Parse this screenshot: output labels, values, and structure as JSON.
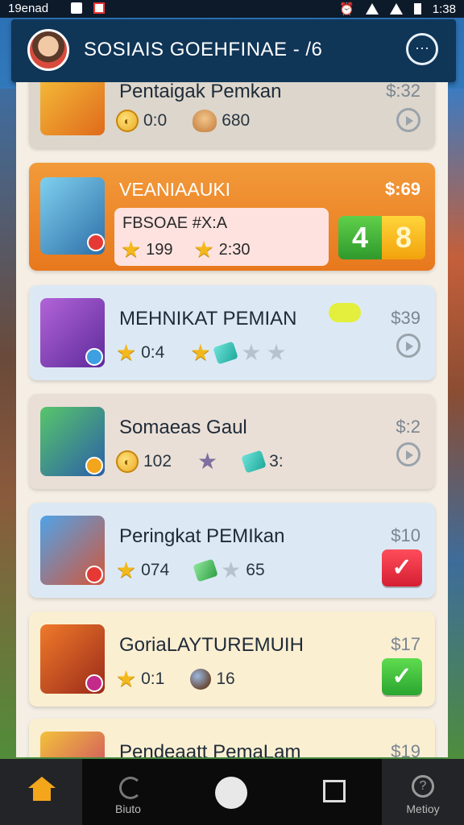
{
  "status_bar": {
    "carrier": "19enad",
    "time": "1:38"
  },
  "header": {
    "title": "SOSIAIS GOEHFINAE - /6"
  },
  "cards": [
    {
      "name": "Pentaigak Pemkan",
      "price": "$:32",
      "stat1": "0:0",
      "stat2": "680",
      "action": "play"
    },
    {
      "name": "VEANIAAUKI",
      "price": "$:69",
      "sub_title": "FBSOAE #X:A",
      "stat1": "199",
      "stat2": "2:30",
      "score_a": "4",
      "score_b": "8"
    },
    {
      "name": "MEHNIKAT PEMIAN",
      "price": "$39",
      "stat1": "0:4",
      "action": "play"
    },
    {
      "name": "Somaeas Gaul",
      "price": "$:2",
      "stat1": "102",
      "stat2": "3:",
      "action": "play"
    },
    {
      "name": "Peringkat PEMIkan",
      "price": "$10",
      "stat1": "074",
      "stat2": "65",
      "action": "check-red"
    },
    {
      "name": "GoriaLAYTUREMUIH",
      "price": "$17",
      "stat1": "0:1",
      "stat2": "16",
      "action": "check-green"
    },
    {
      "name": "Pendeaatt PemaLam",
      "price": "$19"
    }
  ],
  "nav": [
    {
      "label": "",
      "icon": "home-icon"
    },
    {
      "label": "Biuto",
      "icon": "spinner-icon"
    },
    {
      "label": "",
      "icon": "logo-icon"
    },
    {
      "label": "",
      "icon": "square-icon"
    },
    {
      "label": "Metioy",
      "icon": "help-icon"
    }
  ]
}
